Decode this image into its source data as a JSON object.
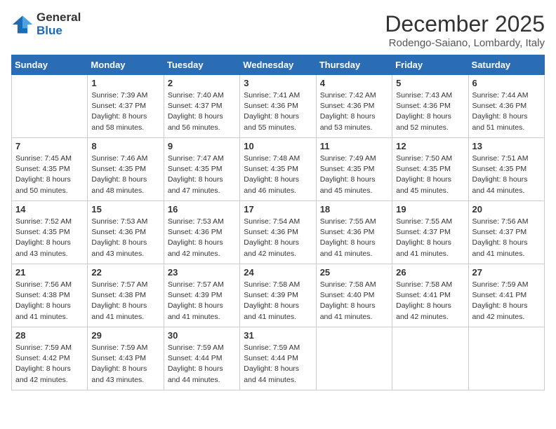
{
  "logo": {
    "general": "General",
    "blue": "Blue"
  },
  "header": {
    "month": "December 2025",
    "location": "Rodengo-Saiano, Lombardy, Italy"
  },
  "days_of_week": [
    "Sunday",
    "Monday",
    "Tuesday",
    "Wednesday",
    "Thursday",
    "Friday",
    "Saturday"
  ],
  "weeks": [
    [
      {
        "day": "",
        "sunrise": "",
        "sunset": "",
        "daylight": ""
      },
      {
        "day": "1",
        "sunrise": "Sunrise: 7:39 AM",
        "sunset": "Sunset: 4:37 PM",
        "daylight": "Daylight: 8 hours and 58 minutes."
      },
      {
        "day": "2",
        "sunrise": "Sunrise: 7:40 AM",
        "sunset": "Sunset: 4:37 PM",
        "daylight": "Daylight: 8 hours and 56 minutes."
      },
      {
        "day": "3",
        "sunrise": "Sunrise: 7:41 AM",
        "sunset": "Sunset: 4:36 PM",
        "daylight": "Daylight: 8 hours and 55 minutes."
      },
      {
        "day": "4",
        "sunrise": "Sunrise: 7:42 AM",
        "sunset": "Sunset: 4:36 PM",
        "daylight": "Daylight: 8 hours and 53 minutes."
      },
      {
        "day": "5",
        "sunrise": "Sunrise: 7:43 AM",
        "sunset": "Sunset: 4:36 PM",
        "daylight": "Daylight: 8 hours and 52 minutes."
      },
      {
        "day": "6",
        "sunrise": "Sunrise: 7:44 AM",
        "sunset": "Sunset: 4:36 PM",
        "daylight": "Daylight: 8 hours and 51 minutes."
      }
    ],
    [
      {
        "day": "7",
        "sunrise": "Sunrise: 7:45 AM",
        "sunset": "Sunset: 4:35 PM",
        "daylight": "Daylight: 8 hours and 50 minutes."
      },
      {
        "day": "8",
        "sunrise": "Sunrise: 7:46 AM",
        "sunset": "Sunset: 4:35 PM",
        "daylight": "Daylight: 8 hours and 48 minutes."
      },
      {
        "day": "9",
        "sunrise": "Sunrise: 7:47 AM",
        "sunset": "Sunset: 4:35 PM",
        "daylight": "Daylight: 8 hours and 47 minutes."
      },
      {
        "day": "10",
        "sunrise": "Sunrise: 7:48 AM",
        "sunset": "Sunset: 4:35 PM",
        "daylight": "Daylight: 8 hours and 46 minutes."
      },
      {
        "day": "11",
        "sunrise": "Sunrise: 7:49 AM",
        "sunset": "Sunset: 4:35 PM",
        "daylight": "Daylight: 8 hours and 45 minutes."
      },
      {
        "day": "12",
        "sunrise": "Sunrise: 7:50 AM",
        "sunset": "Sunset: 4:35 PM",
        "daylight": "Daylight: 8 hours and 45 minutes."
      },
      {
        "day": "13",
        "sunrise": "Sunrise: 7:51 AM",
        "sunset": "Sunset: 4:35 PM",
        "daylight": "Daylight: 8 hours and 44 minutes."
      }
    ],
    [
      {
        "day": "14",
        "sunrise": "Sunrise: 7:52 AM",
        "sunset": "Sunset: 4:35 PM",
        "daylight": "Daylight: 8 hours and 43 minutes."
      },
      {
        "day": "15",
        "sunrise": "Sunrise: 7:53 AM",
        "sunset": "Sunset: 4:36 PM",
        "daylight": "Daylight: 8 hours and 43 minutes."
      },
      {
        "day": "16",
        "sunrise": "Sunrise: 7:53 AM",
        "sunset": "Sunset: 4:36 PM",
        "daylight": "Daylight: 8 hours and 42 minutes."
      },
      {
        "day": "17",
        "sunrise": "Sunrise: 7:54 AM",
        "sunset": "Sunset: 4:36 PM",
        "daylight": "Daylight: 8 hours and 42 minutes."
      },
      {
        "day": "18",
        "sunrise": "Sunrise: 7:55 AM",
        "sunset": "Sunset: 4:36 PM",
        "daylight": "Daylight: 8 hours and 41 minutes."
      },
      {
        "day": "19",
        "sunrise": "Sunrise: 7:55 AM",
        "sunset": "Sunset: 4:37 PM",
        "daylight": "Daylight: 8 hours and 41 minutes."
      },
      {
        "day": "20",
        "sunrise": "Sunrise: 7:56 AM",
        "sunset": "Sunset: 4:37 PM",
        "daylight": "Daylight: 8 hours and 41 minutes."
      }
    ],
    [
      {
        "day": "21",
        "sunrise": "Sunrise: 7:56 AM",
        "sunset": "Sunset: 4:38 PM",
        "daylight": "Daylight: 8 hours and 41 minutes."
      },
      {
        "day": "22",
        "sunrise": "Sunrise: 7:57 AM",
        "sunset": "Sunset: 4:38 PM",
        "daylight": "Daylight: 8 hours and 41 minutes."
      },
      {
        "day": "23",
        "sunrise": "Sunrise: 7:57 AM",
        "sunset": "Sunset: 4:39 PM",
        "daylight": "Daylight: 8 hours and 41 minutes."
      },
      {
        "day": "24",
        "sunrise": "Sunrise: 7:58 AM",
        "sunset": "Sunset: 4:39 PM",
        "daylight": "Daylight: 8 hours and 41 minutes."
      },
      {
        "day": "25",
        "sunrise": "Sunrise: 7:58 AM",
        "sunset": "Sunset: 4:40 PM",
        "daylight": "Daylight: 8 hours and 41 minutes."
      },
      {
        "day": "26",
        "sunrise": "Sunrise: 7:58 AM",
        "sunset": "Sunset: 4:41 PM",
        "daylight": "Daylight: 8 hours and 42 minutes."
      },
      {
        "day": "27",
        "sunrise": "Sunrise: 7:59 AM",
        "sunset": "Sunset: 4:41 PM",
        "daylight": "Daylight: 8 hours and 42 minutes."
      }
    ],
    [
      {
        "day": "28",
        "sunrise": "Sunrise: 7:59 AM",
        "sunset": "Sunset: 4:42 PM",
        "daylight": "Daylight: 8 hours and 42 minutes."
      },
      {
        "day": "29",
        "sunrise": "Sunrise: 7:59 AM",
        "sunset": "Sunset: 4:43 PM",
        "daylight": "Daylight: 8 hours and 43 minutes."
      },
      {
        "day": "30",
        "sunrise": "Sunrise: 7:59 AM",
        "sunset": "Sunset: 4:44 PM",
        "daylight": "Daylight: 8 hours and 44 minutes."
      },
      {
        "day": "31",
        "sunrise": "Sunrise: 7:59 AM",
        "sunset": "Sunset: 4:44 PM",
        "daylight": "Daylight: 8 hours and 44 minutes."
      },
      {
        "day": "",
        "sunrise": "",
        "sunset": "",
        "daylight": ""
      },
      {
        "day": "",
        "sunrise": "",
        "sunset": "",
        "daylight": ""
      },
      {
        "day": "",
        "sunrise": "",
        "sunset": "",
        "daylight": ""
      }
    ]
  ]
}
